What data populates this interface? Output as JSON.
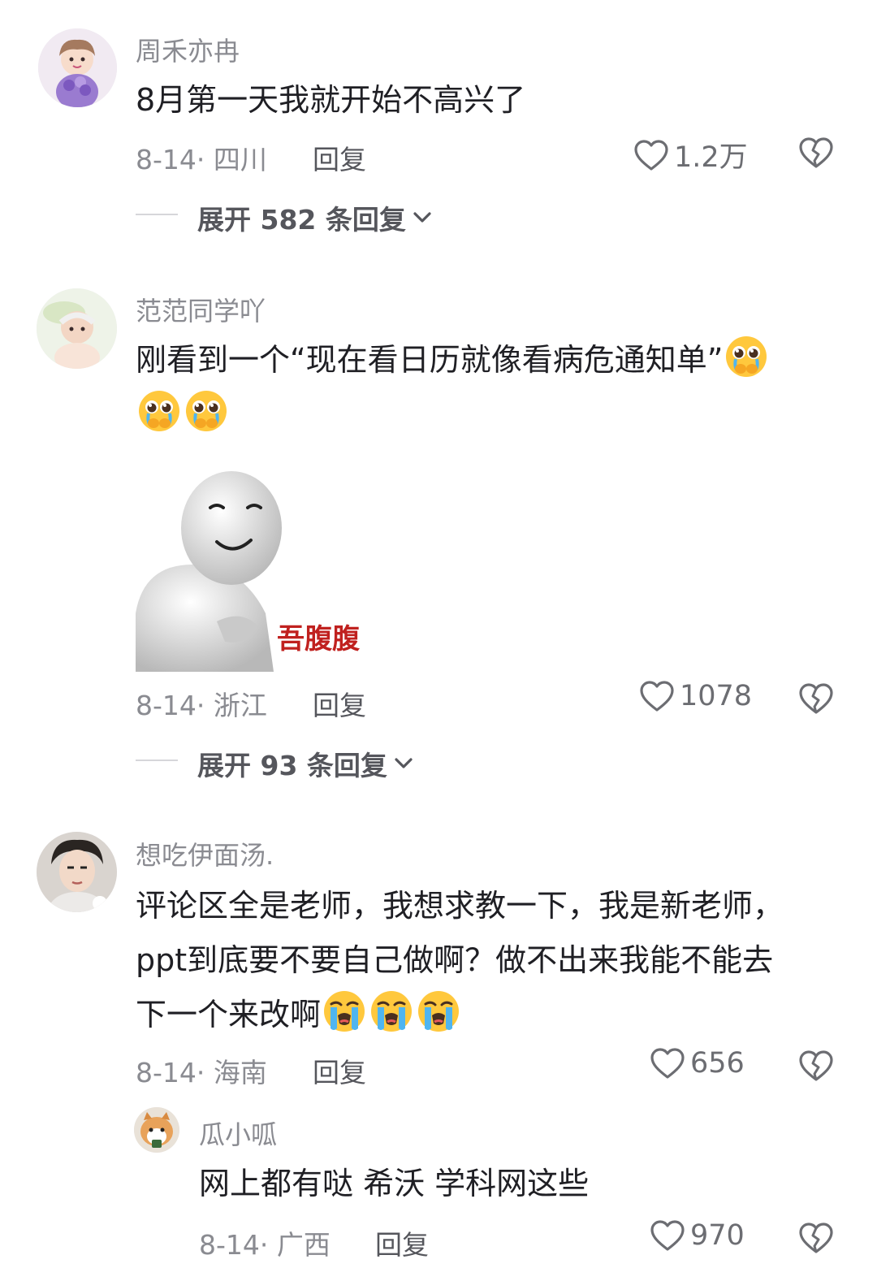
{
  "comments": [
    {
      "username": "周禾亦冉",
      "text": "8月第一天我就开始不高兴了",
      "date_location": "8-14· 四川",
      "reply_label": "回复",
      "likes": "1.2万",
      "expand_label": "展开 582 条回复"
    },
    {
      "username": "范范同学吖",
      "text_line1": "刚看到一个“现在看日历就像看病危通知单”",
      "sticker_caption": "吾腹腹",
      "date_location": "8-14· 浙江",
      "reply_label": "回复",
      "likes": "1078",
      "expand_label": "展开 93 条回复"
    },
    {
      "username": "想吃伊面汤.",
      "text_line1": "评论区全是老师，我想求教一下，我是新老师，",
      "text_line2": "ppt到底要不要自己做啊？做不出来我能不能去",
      "text_line3": "下一个来改啊",
      "date_location": "8-14· 海南",
      "reply_label": "回复",
      "likes": "656"
    },
    {
      "username": "瓜小呱",
      "text": "网上都有哒 希沃 学科网这些",
      "date_location": "8-14· 广西",
      "reply_label": "回复",
      "likes": "970"
    }
  ],
  "icons": {
    "like": "heart-outline-icon",
    "dislike": "broken-heart-icon",
    "expand": "chevron-down-icon",
    "emoji_pleading": "pleading-face-emoji",
    "emoji_crying": "loudly-crying-face-emoji"
  },
  "colors": {
    "text_primary": "#1f1f24",
    "text_secondary": "#8a8b91",
    "emoji_yellow": "#ffc83d",
    "tear_blue": "#4fb5f0",
    "sticker_red": "#c0211f"
  }
}
